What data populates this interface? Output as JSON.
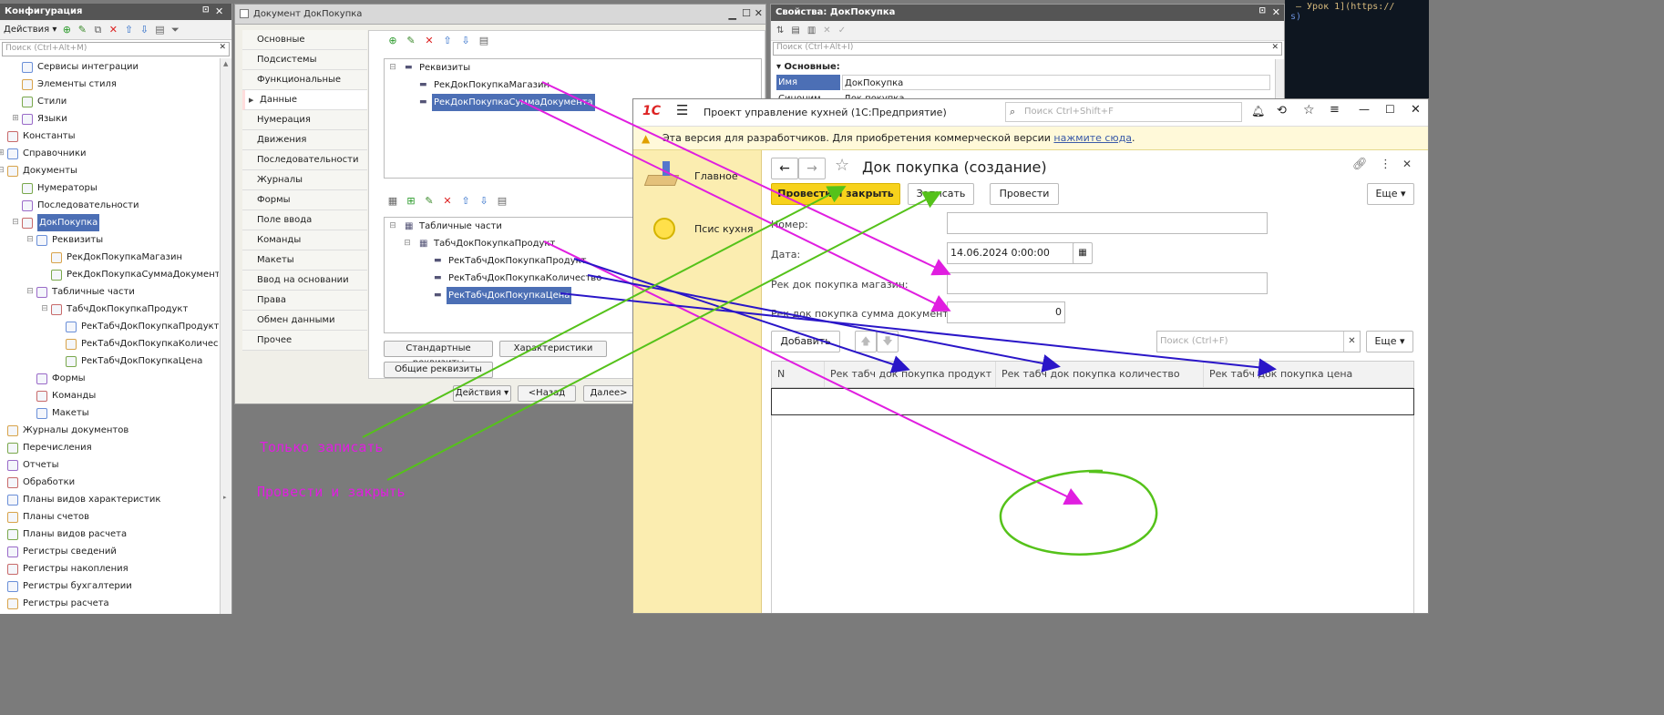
{
  "config_panel": {
    "title": "Конфигурация",
    "actions_label": "Действия",
    "search_placeholder": "Поиск (Ctrl+Alt+M)",
    "tree": [
      {
        "label": "Сервисы интеграции",
        "level": 2,
        "icon": "integration-icon"
      },
      {
        "label": "Элементы стиля",
        "level": 2,
        "icon": "style-element-icon"
      },
      {
        "label": "Стили",
        "level": 2,
        "icon": "styles-icon"
      },
      {
        "label": "Языки",
        "level": 2,
        "icon": "languages-icon",
        "expand": "+"
      },
      {
        "label": "Константы",
        "level": 1,
        "icon": "constants-icon"
      },
      {
        "label": "Справочники",
        "level": 1,
        "icon": "catalogs-icon",
        "expand": "+"
      },
      {
        "label": "Документы",
        "level": 1,
        "icon": "documents-icon",
        "expand": "−"
      },
      {
        "label": "Нумераторы",
        "level": 2,
        "icon": "numerators-icon"
      },
      {
        "label": "Последовательности",
        "level": 2,
        "icon": "sequences-icon"
      },
      {
        "label": "ДокПокупка",
        "level": 2,
        "icon": "document-icon",
        "expand": "−",
        "selected": true
      },
      {
        "label": "Реквизиты",
        "level": 3,
        "icon": "attributes-icon",
        "expand": "−"
      },
      {
        "label": "РекДокПокупкаМагазин",
        "level": 4,
        "icon": "attribute-icon"
      },
      {
        "label": "РекДокПокупкаСуммаДокумент",
        "level": 4,
        "icon": "attribute-icon"
      },
      {
        "label": "Табличные части",
        "level": 3,
        "icon": "tabular-icon",
        "expand": "−"
      },
      {
        "label": "ТабчДокПокупкаПродукт",
        "level": 4,
        "icon": "table-icon",
        "expand": "−"
      },
      {
        "label": "РекТабчДокПокупкаПродукт",
        "level": 5,
        "icon": "attribute-icon"
      },
      {
        "label": "РекТабчДокПокупкаКоличес",
        "level": 5,
        "icon": "attribute-icon"
      },
      {
        "label": "РекТабчДокПокупкаЦена",
        "level": 5,
        "icon": "attribute-icon"
      },
      {
        "label": "Формы",
        "level": 3,
        "icon": "forms-icon"
      },
      {
        "label": "Команды",
        "level": 3,
        "icon": "commands-icon"
      },
      {
        "label": "Макеты",
        "level": 3,
        "icon": "templates-icon"
      },
      {
        "label": "Журналы документов",
        "level": 1,
        "icon": "journals-icon"
      },
      {
        "label": "Перечисления",
        "level": 1,
        "icon": "enums-icon"
      },
      {
        "label": "Отчеты",
        "level": 1,
        "icon": "reports-icon"
      },
      {
        "label": "Обработки",
        "level": 1,
        "icon": "processing-icon"
      },
      {
        "label": "Планы видов характеристик",
        "level": 1,
        "icon": "char-plans-icon"
      },
      {
        "label": "Планы счетов",
        "level": 1,
        "icon": "accounts-icon"
      },
      {
        "label": "Планы видов расчета",
        "level": 1,
        "icon": "calc-plans-icon"
      },
      {
        "label": "Регистры сведений",
        "level": 1,
        "icon": "info-registers-icon"
      },
      {
        "label": "Регистры накопления",
        "level": 1,
        "icon": "accum-registers-icon"
      },
      {
        "label": "Регистры бухгалтерии",
        "level": 1,
        "icon": "acc-registers-icon"
      },
      {
        "label": "Регистры расчета",
        "level": 1,
        "icon": "calc-registers-icon"
      }
    ]
  },
  "doc_window": {
    "title": "Документ ДокПокупка",
    "nav": [
      "Основные",
      "Подсистемы",
      "Функциональные опц...",
      "Данные",
      "Нумерация",
      "Движения",
      "Последовательности",
      "Журналы",
      "Формы",
      "Поле ввода",
      "Команды",
      "Макеты",
      "Ввод на основании",
      "Права",
      "Обмен данными",
      "Прочее"
    ],
    "active_nav": "Данные",
    "attributes_root": "Реквизиты",
    "attributes": [
      "РекДокПокупкаМагазин",
      "РекДокПокупкаСуммаДокумента"
    ],
    "tabular_root": "Табличные части",
    "tabular_part": "ТабчДокПокупкаПродукт",
    "tabular_attributes": [
      "РекТабчДокПокупкаПродукт",
      "РекТабчДокПокупкаКоличество",
      "РекТабчДокПокупкаЦена"
    ],
    "btn_standard": "Стандартные реквизиты",
    "btn_characteristics": "Характеристики",
    "btn_common": "Общие реквизиты",
    "btn_actions": "Действия",
    "btn_back": "<Назад",
    "btn_next": "Далее>"
  },
  "properties": {
    "title": "Свойства: ДокПокупка",
    "search_placeholder": "Поиск (Ctrl+Alt+I)",
    "section": "Основные:",
    "rows": [
      {
        "name": "Имя",
        "value": "ДокПокупка"
      },
      {
        "name": "Синоним",
        "value": "Док покупка"
      }
    ]
  },
  "terminal": {
    "line1": "– Урок 1](https://",
    "line2": "s)"
  },
  "client": {
    "app_title": "Проект управление кухней  (1С:Предприятие)",
    "search_placeholder": "Поиск Ctrl+Shift+F",
    "warning_text": "Эта версия для разработчиков. Для приобретения коммерческой версии ",
    "warning_link": "нажмите сюда",
    "warning_end": ".",
    "sections": [
      "Главное",
      "Псис кухня"
    ],
    "form_title": "Док покупка (создание)",
    "btn_post_close": "Провести и закрыть",
    "btn_save": "Записать",
    "btn_post": "Провести",
    "btn_more": "Еще",
    "label_number": "Номер:",
    "label_date": "Дата:",
    "date_value": "14.06.2024  0:00:00",
    "label_shop": "Рек док покупка магазин:",
    "label_sum": "Рек док покупка сумма документа:",
    "sum_value": "0",
    "btn_add": "Добавить",
    "table_search_placeholder": "Поиск (Ctrl+F)",
    "btn_more2": "Еще",
    "columns": [
      "N",
      "Рек табч док покупка продукт",
      "Рек табч док покупка количество",
      "Рек табч док покупка цена"
    ]
  },
  "annotations": {
    "only_save": "Только записать",
    "post_close": "Провести и закрыть"
  },
  "colors": {
    "magenta_arrow": "#e01ee0",
    "blue_arrow": "#2a16c8",
    "green_arrow": "#55c21a",
    "section_bg": "#fbedb0",
    "primary_btn": "#f7d21c"
  }
}
